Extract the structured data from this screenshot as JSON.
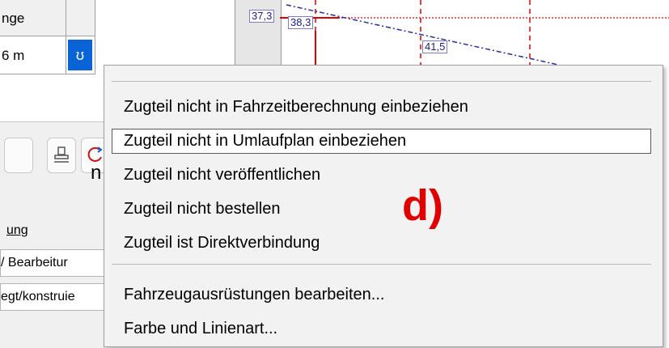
{
  "grid": {
    "header_label": "nge",
    "value_label": "6 m",
    "checkbox_glyph": "ʊ"
  },
  "left_panel": {
    "cut_text": "n",
    "link_label": "ung",
    "field1_value": "/ Bearbeitur",
    "field2_value": "egt/konstruie"
  },
  "graph": {
    "labels": [
      "37,3",
      "38,3",
      "41,5"
    ]
  },
  "context_menu": {
    "items": [
      {
        "label": "Zugteil nicht in Fahrzeitberechnung einbeziehen"
      },
      {
        "label": "Zugteil nicht in Umlaufplan einbeziehen"
      },
      {
        "label": "Zugteil nicht veröffentlichen"
      },
      {
        "label": "Zugteil nicht bestellen"
      },
      {
        "label": "Zugteil ist Direktverbindung"
      },
      {
        "label": "Fahrzeugausrüstungen bearbeiten..."
      },
      {
        "label": "Farbe und Linienart..."
      }
    ],
    "hovered_index": 1
  },
  "annotation": {
    "text": "d)",
    "color": "#e00000"
  },
  "colors": {
    "menu_bg": "#f2f2f2",
    "checkbox_selected": "#0a64d8",
    "graph_dashed_red": "#e00000",
    "graph_dotted_blue": "#2a2aa8"
  }
}
